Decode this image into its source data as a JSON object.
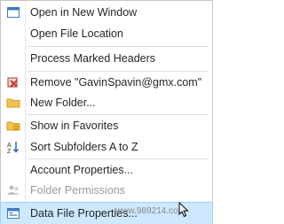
{
  "menu": {
    "items": [
      {
        "label": "Open in New Window",
        "icon": "open-new-window-icon"
      },
      {
        "label": "Open File Location",
        "icon": ""
      },
      {
        "label": "Process Marked Headers",
        "icon": ""
      },
      {
        "label": "Remove \"GavinSpavin@gmx.com\"",
        "icon": "remove-account-icon"
      },
      {
        "label": "New Folder...",
        "icon": "new-folder-icon"
      },
      {
        "label": "Show in Favorites",
        "icon": "favorites-icon"
      },
      {
        "label": "Sort Subfolders A to Z",
        "icon": "sort-az-icon"
      },
      {
        "label": "Account Properties...",
        "icon": ""
      },
      {
        "label": "Folder Permissions",
        "icon": "folder-permissions-icon"
      },
      {
        "label": "Data File Properties...",
        "icon": "data-file-properties-icon"
      }
    ]
  },
  "watermark": "www.989214.com",
  "colors": {
    "hover_bg": "#cde8ff",
    "folder_yellow": "#f4c04f",
    "remove_red": "#c0392b",
    "star_gold": "#f0b429"
  }
}
